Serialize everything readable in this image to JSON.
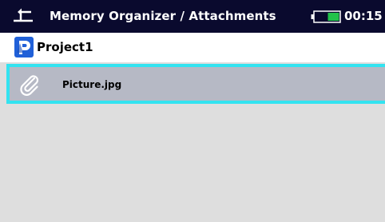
{
  "header": {
    "title": "Memory Organizer / Attachments",
    "time": "00:15",
    "back_icon": "back-arrow-icon",
    "battery_icon": "battery-icon",
    "battery_level": 0.45,
    "background": "#0a0a2e",
    "battery_color": "#22c24a"
  },
  "project": {
    "label": "Project1",
    "icon": "project-icon",
    "icon_color": "#2060d8"
  },
  "attachments": {
    "items": [
      {
        "label": "Picture.jpg",
        "icon": "paperclip-icon",
        "selected": true
      }
    ],
    "selection_color": "#33e3f0",
    "item_background": "#b6b9c5",
    "list_background": "#dedede"
  }
}
